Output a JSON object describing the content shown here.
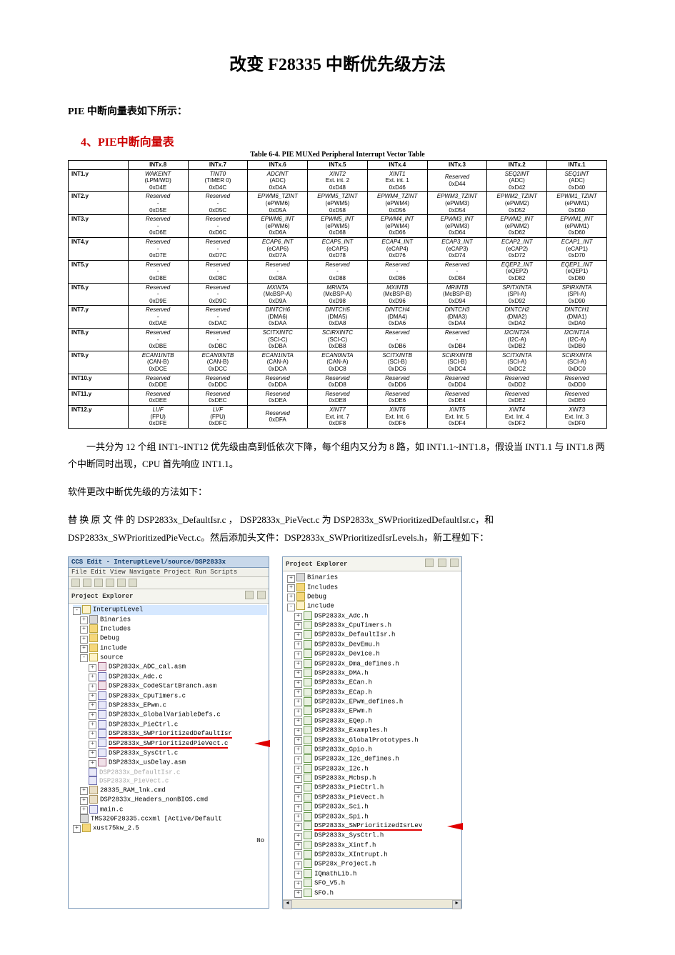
{
  "doc": {
    "title": "改变 F28335 中断优先级方法",
    "section1": "PIE 中断向量表如下所示：",
    "red_heading": "4、PIE中断向量表",
    "table_caption": "Table 6-4. PIE MUXed Peripheral Interrupt Vector Table",
    "para1": "一共分为 12 个组 INT1~INT12 优先级由高到低依次下降，每个组内又分为 8 路，如 INT1.1~INT1.8，假设当 INT1.1 与 INT1.8 两个中断同时出现，CPU 首先响应 INT1.1。",
    "para2": "软件更改中断优先级的方法如下：",
    "para3": "替 换 原 文 件 的  DSP2833x_DefaultIsr.c ， DSP2833x_PieVect.c  为 DSP2833x_SWPrioritizedDefaultIsr.c，和 DSP2833x_SWPrioritizedPieVect.c。然后添加头文件：DSP2833x_SWPrioritizedIsrLevels.h，新工程如下："
  },
  "chart_data": {
    "type": "table",
    "title": "Table 6-4. PIE MUXed Peripheral Interrupt Vector Table",
    "columns": [
      "",
      "INTx.8",
      "INTx.7",
      "INTx.6",
      "INTx.5",
      "INTx.4",
      "INTx.3",
      "INTx.2",
      "INTx.1"
    ],
    "rows": [
      {
        "label": "INT1.y",
        "cells": [
          {
            "l1": "WAKEINT",
            "l2": "(LPM/WD)",
            "l3": "0xD4E"
          },
          {
            "l1": "TINT0",
            "l2": "(TIMER 0)",
            "l3": "0xD4C"
          },
          {
            "l1": "ADCINT",
            "l2": "(ADC)",
            "l3": "0xD4A"
          },
          {
            "l1": "XINT2",
            "l2": "Ext. int. 2",
            "l3": "0xD48"
          },
          {
            "l1": "XINT1",
            "l2": "Ext. int. 1",
            "l3": "0xD46"
          },
          {
            "l1": "Reserved",
            "l2": "",
            "l3": "0xD44"
          },
          {
            "l1": "SEQ2INT",
            "l2": "(ADC)",
            "l3": "0xD42"
          },
          {
            "l1": "SEQ1INT",
            "l2": "(ADC)",
            "l3": "0xD40"
          }
        ]
      },
      {
        "label": "INT2.y",
        "cells": [
          {
            "l1": "Reserved",
            "l2": "-",
            "l3": "0xD5E"
          },
          {
            "l1": "Reserved",
            "l2": "-",
            "l3": "0xD5C"
          },
          {
            "l1": "EPWM6_TZINT",
            "l2": "(ePWM6)",
            "l3": "0xD5A"
          },
          {
            "l1": "EPWM5_TZINT",
            "l2": "(ePWM5)",
            "l3": "0xD58"
          },
          {
            "l1": "EPWM4_TZINT",
            "l2": "(ePWM4)",
            "l3": "0xD56"
          },
          {
            "l1": "EPWM3_TZINT",
            "l2": "(ePWM3)",
            "l3": "0xD54"
          },
          {
            "l1": "EPWM2_TZINT",
            "l2": "(ePWM2)",
            "l3": "0xD52"
          },
          {
            "l1": "EPWM1_TZINT",
            "l2": "(ePWM1)",
            "l3": "0xD50"
          }
        ]
      },
      {
        "label": "INT3.y",
        "cells": [
          {
            "l1": "Reserved",
            "l2": "-",
            "l3": "0xD6E"
          },
          {
            "l1": "Reserved",
            "l2": "-",
            "l3": "0xD6C"
          },
          {
            "l1": "EPWM6_INT",
            "l2": "(ePWM6)",
            "l3": "0xD6A"
          },
          {
            "l1": "EPWM5_INT",
            "l2": "(ePWM5)",
            "l3": "0xD68"
          },
          {
            "l1": "EPWM4_INT",
            "l2": "(ePWM4)",
            "l3": "0xD66"
          },
          {
            "l1": "EPWM3_INT",
            "l2": "(ePWM3)",
            "l3": "0xD64"
          },
          {
            "l1": "EPWM2_INT",
            "l2": "(ePWM2)",
            "l3": "0xD62"
          },
          {
            "l1": "EPWM1_INT",
            "l2": "(ePWM1)",
            "l3": "0xD60"
          }
        ]
      },
      {
        "label": "INT4.y",
        "cells": [
          {
            "l1": "Reserved",
            "l2": "-",
            "l3": "0xD7E"
          },
          {
            "l1": "Reserved",
            "l2": "-",
            "l3": "0xD7C"
          },
          {
            "l1": "ECAP6_INT",
            "l2": "(eCAP6)",
            "l3": "0xD7A"
          },
          {
            "l1": "ECAP5_INT",
            "l2": "(eCAP5)",
            "l3": "0xD78"
          },
          {
            "l1": "ECAP4_INT",
            "l2": "(eCAP4)",
            "l3": "0xD76"
          },
          {
            "l1": "ECAP3_INT",
            "l2": "(eCAP3)",
            "l3": "0xD74"
          },
          {
            "l1": "ECAP2_INT",
            "l2": "(eCAP2)",
            "l3": "0xD72"
          },
          {
            "l1": "ECAP1_INT",
            "l2": "(eCAP1)",
            "l3": "0xD70"
          }
        ]
      },
      {
        "label": "INT5.y",
        "cells": [
          {
            "l1": "Reserved",
            "l2": "-",
            "l3": "0xD8E"
          },
          {
            "l1": "Reserved",
            "l2": "-",
            "l3": "0xD8C"
          },
          {
            "l1": "Reserved",
            "l2": "-",
            "l3": "0xD8A"
          },
          {
            "l1": "Reserved",
            "l2": "-",
            "l3": "0xD88"
          },
          {
            "l1": "Reserved",
            "l2": "-",
            "l3": "0xD86"
          },
          {
            "l1": "Reserved",
            "l2": "-",
            "l3": "0xD84"
          },
          {
            "l1": "EQEP2_INT",
            "l2": "(eQEP2)",
            "l3": "0xD82"
          },
          {
            "l1": "EQEP1_INT",
            "l2": "(eQEP1)",
            "l3": "0xD80"
          }
        ]
      },
      {
        "label": "INT6.y",
        "cells": [
          {
            "l1": "Reserved",
            "l2": "-",
            "l3": "0xD9E"
          },
          {
            "l1": "Reserved",
            "l2": "-",
            "l3": "0xD9C"
          },
          {
            "l1": "MXINTA",
            "l2": "(McBSP-A)",
            "l3": "0xD9A"
          },
          {
            "l1": "MRINTA",
            "l2": "(McBSP-A)",
            "l3": "0xD98"
          },
          {
            "l1": "MXINTB",
            "l2": "(McBSP-B)",
            "l3": "0xD96"
          },
          {
            "l1": "MRINTB",
            "l2": "(McBSP-B)",
            "l3": "0xD94"
          },
          {
            "l1": "SPITXINTA",
            "l2": "(SPI-A)",
            "l3": "0xD92"
          },
          {
            "l1": "SPIRXINTA",
            "l2": "(SPI-A)",
            "l3": "0xD90"
          }
        ]
      },
      {
        "label": "INT7.y",
        "cells": [
          {
            "l1": "Reserved",
            "l2": "-",
            "l3": "0xDAE"
          },
          {
            "l1": "Reserved",
            "l2": "-",
            "l3": "0xDAC"
          },
          {
            "l1": "DINTCH6",
            "l2": "(DMA6)",
            "l3": "0xDAA"
          },
          {
            "l1": "DINTCH5",
            "l2": "(DMA5)",
            "l3": "0xDA8"
          },
          {
            "l1": "DINTCH4",
            "l2": "(DMA4)",
            "l3": "0xDA6"
          },
          {
            "l1": "DINTCH3",
            "l2": "(DMA3)",
            "l3": "0xDA4"
          },
          {
            "l1": "DINTCH2",
            "l2": "(DMA2)",
            "l3": "0xDA2"
          },
          {
            "l1": "DINTCH1",
            "l2": "(DMA1)",
            "l3": "0xDA0"
          }
        ]
      },
      {
        "label": "INT8.y",
        "cells": [
          {
            "l1": "Reserved",
            "l2": "-",
            "l3": "0xDBE"
          },
          {
            "l1": "Reserved",
            "l2": "-",
            "l3": "0xDBC"
          },
          {
            "l1": "SCITXINTC",
            "l2": "(SCI-C)",
            "l3": "0xDBA"
          },
          {
            "l1": "SCIRXINTC",
            "l2": "(SCI-C)",
            "l3": "0xDB8"
          },
          {
            "l1": "Reserved",
            "l2": "-",
            "l3": "0xDB6"
          },
          {
            "l1": "Reserved",
            "l2": "-",
            "l3": "0xDB4"
          },
          {
            "l1": "I2CINT2A",
            "l2": "(I2C-A)",
            "l3": "0xDB2"
          },
          {
            "l1": "I2CINT1A",
            "l2": "(I2C-A)",
            "l3": "0xDB0"
          }
        ]
      },
      {
        "label": "INT9.y",
        "cells": [
          {
            "l1": "ECAN1INTB",
            "l2": "(CAN-B)",
            "l3": "0xDCE"
          },
          {
            "l1": "ECAN0INTB",
            "l2": "(CAN-B)",
            "l3": "0xDCC"
          },
          {
            "l1": "ECAN1INTA",
            "l2": "(CAN-A)",
            "l3": "0xDCA"
          },
          {
            "l1": "ECAN0INTA",
            "l2": "(CAN-A)",
            "l3": "0xDC8"
          },
          {
            "l1": "SCITXINTB",
            "l2": "(SCI-B)",
            "l3": "0xDC6"
          },
          {
            "l1": "SCIRXINTB",
            "l2": "(SCI-B)",
            "l3": "0xDC4"
          },
          {
            "l1": "SCITXINTA",
            "l2": "(SCI-A)",
            "l3": "0xDC2"
          },
          {
            "l1": "SCIRXINTA",
            "l2": "(SCI-A)",
            "l3": "0xDC0"
          }
        ]
      },
      {
        "label": "INT10.y",
        "cells": [
          {
            "l1": "Reserved",
            "l2": "",
            "l3": "0xDDE"
          },
          {
            "l1": "Reserved",
            "l2": "",
            "l3": "0xDDC"
          },
          {
            "l1": "Reserved",
            "l2": "",
            "l3": "0xDDA"
          },
          {
            "l1": "Reserved",
            "l2": "",
            "l3": "0xDD8"
          },
          {
            "l1": "Reserved",
            "l2": "",
            "l3": "0xDD6"
          },
          {
            "l1": "Reserved",
            "l2": "",
            "l3": "0xDD4"
          },
          {
            "l1": "Reserved",
            "l2": "",
            "l3": "0xDD2"
          },
          {
            "l1": "Reserved",
            "l2": "",
            "l3": "0xDD0"
          }
        ]
      },
      {
        "label": "INT11.y",
        "cells": [
          {
            "l1": "Reserved",
            "l2": "",
            "l3": "0xDEE"
          },
          {
            "l1": "Reserved",
            "l2": "",
            "l3": "0xDEC"
          },
          {
            "l1": "Reserved",
            "l2": "",
            "l3": "0xDEA"
          },
          {
            "l1": "Reserved",
            "l2": "",
            "l3": "0xDE8"
          },
          {
            "l1": "Reserved",
            "l2": "",
            "l3": "0xDE6"
          },
          {
            "l1": "Reserved",
            "l2": "",
            "l3": "0xDE4"
          },
          {
            "l1": "Reserved",
            "l2": "",
            "l3": "0xDE2"
          },
          {
            "l1": "Reserved",
            "l2": "",
            "l3": "0xDE0"
          }
        ]
      },
      {
        "label": "INT12.y",
        "cells": [
          {
            "l1": "LUF",
            "l2": "(FPU)",
            "l3": "0xDFE"
          },
          {
            "l1": "LVF",
            "l2": "(FPU)",
            "l3": "0xDFC"
          },
          {
            "l1": "Reserved",
            "l2": "",
            "l3": "0xDFA"
          },
          {
            "l1": "XINT7",
            "l2": "Ext. int. 7",
            "l3": "0xDF8"
          },
          {
            "l1": "XINT6",
            "l2": "Ext. Int. 6",
            "l3": "0xDF6"
          },
          {
            "l1": "XINT5",
            "l2": "Ext. Int. 5",
            "l3": "0xDF4"
          },
          {
            "l1": "XINT4",
            "l2": "Ext. Int. 4",
            "l3": "0xDF2"
          },
          {
            "l1": "XINT3",
            "l2": "Ext. Int. 3",
            "l3": "0xDF0"
          }
        ]
      }
    ]
  },
  "left_ide": {
    "title": "CCS Edit - InteruptLevel/source/DSP2833x",
    "menu": "File  Edit  View  Navigate  Project  Run  Scripts",
    "tabheader": "Project Explorer",
    "footer": "No",
    "tree": [
      {
        "d": 0,
        "exp": "-",
        "icon": "folder-open",
        "text": "InteruptLevel",
        "hl": true
      },
      {
        "d": 1,
        "exp": "+",
        "icon": "bin",
        "text": "Binaries"
      },
      {
        "d": 1,
        "exp": "+",
        "icon": "folder",
        "text": "Includes"
      },
      {
        "d": 1,
        "exp": "+",
        "icon": "folder",
        "text": "Debug"
      },
      {
        "d": 1,
        "exp": "+",
        "icon": "folder",
        "text": "include"
      },
      {
        "d": 1,
        "exp": "-",
        "icon": "folder-open",
        "text": "source"
      },
      {
        "d": 2,
        "exp": "+",
        "icon": "asm",
        "text": "DSP2833x_ADC_cal.asm"
      },
      {
        "d": 2,
        "exp": "+",
        "icon": "cfile",
        "text": "DSP2833x_Adc.c"
      },
      {
        "d": 2,
        "exp": "+",
        "icon": "asm",
        "text": "DSP2833x_CodeStartBranch.asm"
      },
      {
        "d": 2,
        "exp": "+",
        "icon": "cfile",
        "text": "DSP2833x_CpuTimers.c"
      },
      {
        "d": 2,
        "exp": "+",
        "icon": "cfile",
        "text": "DSP2833x_EPwm.c"
      },
      {
        "d": 2,
        "exp": "+",
        "icon": "cfile",
        "text": "DSP2833x_GlobalVariableDefs.c"
      },
      {
        "d": 2,
        "exp": "+",
        "icon": "cfile",
        "text": "DSP2833x_PieCtrl.c"
      },
      {
        "d": 2,
        "exp": "+",
        "icon": "cfile",
        "text": "DSP2833x_SWPrioritizedDefaultIsr",
        "underline": true
      },
      {
        "d": 2,
        "exp": "+",
        "icon": "cfile",
        "text": "DSP2833x_SWPrioritizedPieVect.c",
        "underline": true,
        "arrow": true
      },
      {
        "d": 2,
        "exp": "+",
        "icon": "cfile",
        "text": "DSP2833x_SysCtrl.c"
      },
      {
        "d": 2,
        "exp": "+",
        "icon": "asm",
        "text": "DSP2833x_usDelay.asm"
      },
      {
        "d": 2,
        "exp": "",
        "icon": "cfile",
        "text": "DSP2833x_DefaultIsr.c",
        "grey": true
      },
      {
        "d": 2,
        "exp": "",
        "icon": "cfile",
        "text": "DSP2833x_PieVect.c",
        "grey": true
      },
      {
        "d": 1,
        "exp": "+",
        "icon": "cmd",
        "text": "28335_RAM_lnk.cmd"
      },
      {
        "d": 1,
        "exp": "+",
        "icon": "cmd",
        "text": "DSP2833x_Headers_nonBIOS.cmd"
      },
      {
        "d": 1,
        "exp": "+",
        "icon": "cfile",
        "text": "main.c"
      },
      {
        "d": 1,
        "exp": "",
        "icon": "bin",
        "text": "TMS320F28335.ccxml [Active/Default"
      },
      {
        "d": 0,
        "exp": "+",
        "icon": "folder",
        "text": "xust75kw_2.5"
      }
    ]
  },
  "right_ide": {
    "tabheader": "Project Explorer",
    "tree": [
      {
        "d": 0,
        "exp": "+",
        "icon": "bin",
        "text": "Binaries"
      },
      {
        "d": 0,
        "exp": "+",
        "icon": "folder",
        "text": "Includes"
      },
      {
        "d": 0,
        "exp": "+",
        "icon": "folder",
        "text": "Debug"
      },
      {
        "d": 0,
        "exp": "-",
        "icon": "folder-open",
        "text": "include"
      },
      {
        "d": 1,
        "exp": "+",
        "icon": "hfile",
        "text": "DSP2833x_Adc.h"
      },
      {
        "d": 1,
        "exp": "+",
        "icon": "hfile",
        "text": "DSP2833x_CpuTimers.h"
      },
      {
        "d": 1,
        "exp": "+",
        "icon": "hfile",
        "text": "DSP2833x_DefaultIsr.h"
      },
      {
        "d": 1,
        "exp": "+",
        "icon": "hfile",
        "text": "DSP2833x_DevEmu.h"
      },
      {
        "d": 1,
        "exp": "+",
        "icon": "hfile",
        "text": "DSP2833x_Device.h"
      },
      {
        "d": 1,
        "exp": "+",
        "icon": "hfile",
        "text": "DSP2833x_Dma_defines.h"
      },
      {
        "d": 1,
        "exp": "+",
        "icon": "hfile",
        "text": "DSP2833x_DMA.h"
      },
      {
        "d": 1,
        "exp": "+",
        "icon": "hfile",
        "text": "DSP2833x_ECan.h"
      },
      {
        "d": 1,
        "exp": "+",
        "icon": "hfile",
        "text": "DSP2833x_ECap.h"
      },
      {
        "d": 1,
        "exp": "+",
        "icon": "hfile",
        "text": "DSP2833x_EPwm_defines.h"
      },
      {
        "d": 1,
        "exp": "+",
        "icon": "hfile",
        "text": "DSP2833x_EPwm.h"
      },
      {
        "d": 1,
        "exp": "+",
        "icon": "hfile",
        "text": "DSP2833x_EQep.h"
      },
      {
        "d": 1,
        "exp": "+",
        "icon": "hfile",
        "text": "DSP2833x_Examples.h"
      },
      {
        "d": 1,
        "exp": "+",
        "icon": "hfile",
        "text": "DSP2833x_GlobalPrototypes.h"
      },
      {
        "d": 1,
        "exp": "+",
        "icon": "hfile",
        "text": "DSP2833x_Gpio.h"
      },
      {
        "d": 1,
        "exp": "+",
        "icon": "hfile",
        "text": "DSP2833x_I2c_defines.h"
      },
      {
        "d": 1,
        "exp": "+",
        "icon": "hfile",
        "text": "DSP2833x_I2c.h"
      },
      {
        "d": 1,
        "exp": "+",
        "icon": "hfile",
        "text": "DSP2833x_Mcbsp.h"
      },
      {
        "d": 1,
        "exp": "+",
        "icon": "hfile",
        "text": "DSP2833x_PieCtrl.h"
      },
      {
        "d": 1,
        "exp": "+",
        "icon": "hfile",
        "text": "DSP2833x_PieVect.h"
      },
      {
        "d": 1,
        "exp": "+",
        "icon": "hfile",
        "text": "DSP2833x_Sci.h"
      },
      {
        "d": 1,
        "exp": "+",
        "icon": "hfile",
        "text": "DSP2833x_Spi.h"
      },
      {
        "d": 1,
        "exp": "+",
        "icon": "hfile",
        "text": "DSP2833x_SWPrioritizedIsrLev",
        "underline": true,
        "arrow": true
      },
      {
        "d": 1,
        "exp": "+",
        "icon": "hfile",
        "text": "DSP2833x_SysCtrl.h"
      },
      {
        "d": 1,
        "exp": "+",
        "icon": "hfile",
        "text": "DSP2833x_Xintf.h"
      },
      {
        "d": 1,
        "exp": "+",
        "icon": "hfile",
        "text": "DSP2833x_XIntrupt.h"
      },
      {
        "d": 1,
        "exp": "+",
        "icon": "hfile",
        "text": "DSP28x_Project.h"
      },
      {
        "d": 1,
        "exp": "+",
        "icon": "hfile",
        "text": "IQmathLib.h"
      },
      {
        "d": 1,
        "exp": "+",
        "icon": "hfile",
        "text": "SFO_V5.h"
      },
      {
        "d": 1,
        "exp": "+",
        "icon": "hfile",
        "text": "SFO.h"
      }
    ]
  }
}
